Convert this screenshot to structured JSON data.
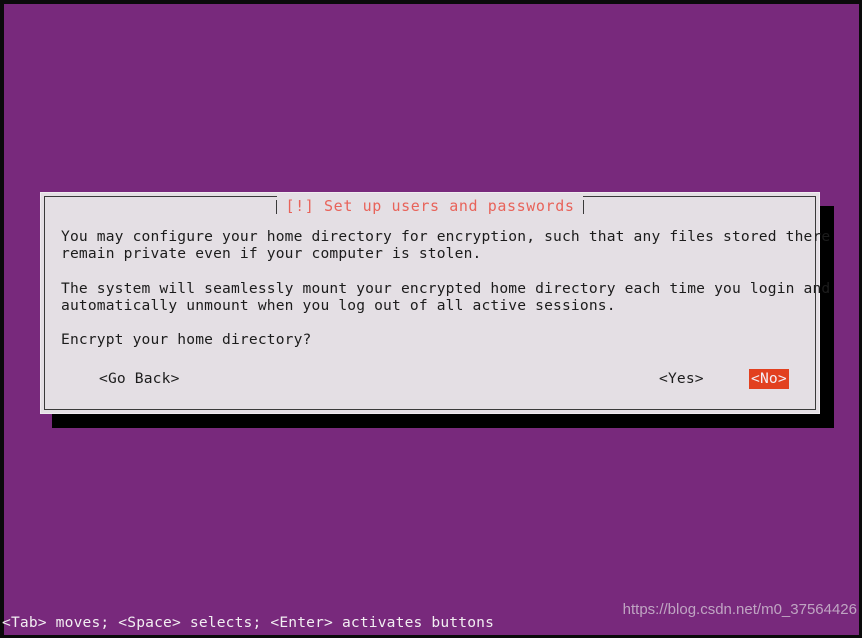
{
  "screen": {
    "background_color": "#78297c",
    "border_color": "#0a0a0a"
  },
  "dialog": {
    "title": "[!] Set up users and passwords",
    "title_color": "#e8635a",
    "background_color": "#e4dfe4",
    "shadow_color": "#000000",
    "paragraphs": [
      "You may configure your home directory for encryption, such that any files stored there\nremain private even if your computer is stolen.",
      "The system will seamlessly mount your encrypted home directory each time you login and\nautomatically unmount when you log out of all active sessions.",
      "Encrypt your home directory?"
    ],
    "buttons": {
      "go_back": "<Go Back>",
      "yes": "<Yes>",
      "no": "<No>",
      "selected": "<No>",
      "selected_background_color": "#e2401f",
      "selected_text_color": "#f4eef4"
    }
  },
  "help_bar": {
    "text": "<Tab> moves; <Space> selects; <Enter> activates buttons",
    "text_color": "#f2eef2"
  },
  "watermark": {
    "text": "https://blog.csdn.net/m0_37564426"
  }
}
